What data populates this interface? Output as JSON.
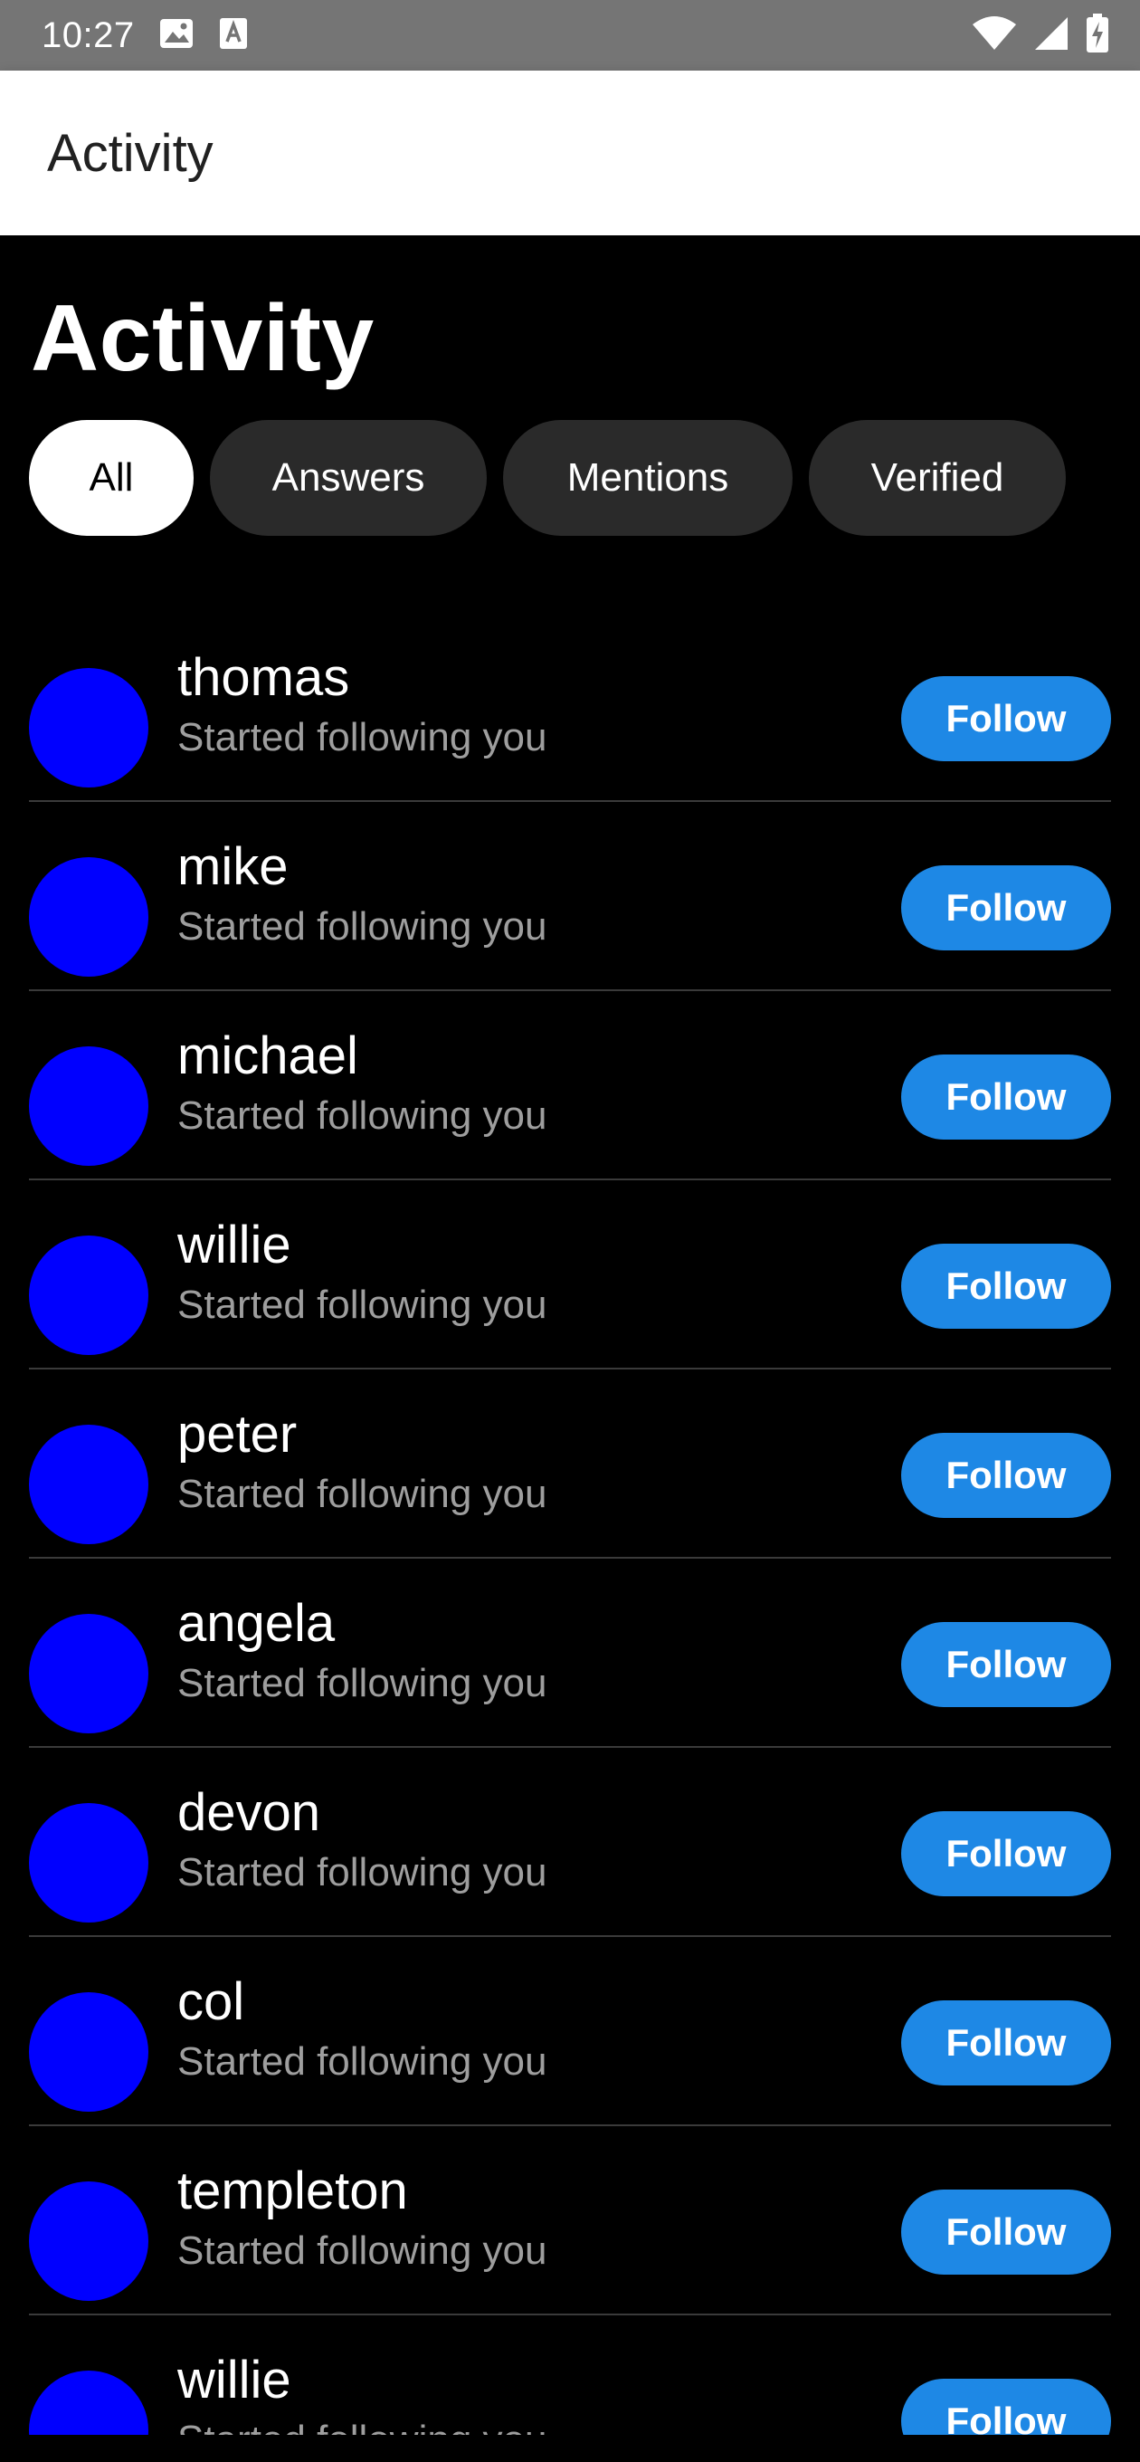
{
  "status_bar": {
    "time": "10:27",
    "icons_left": [
      "image-icon",
      "text-a-icon"
    ],
    "icons_right": [
      "wifi-icon",
      "signal-icon",
      "battery-charging-icon"
    ]
  },
  "app_bar": {
    "title": "Activity"
  },
  "page": {
    "heading": "Activity"
  },
  "filters": [
    {
      "label": "All",
      "selected": true
    },
    {
      "label": "Answers",
      "selected": false
    },
    {
      "label": "Mentions",
      "selected": false
    },
    {
      "label": "Verified",
      "selected": false
    }
  ],
  "activity": [
    {
      "name": "thomas",
      "subtitle": "Started following you",
      "action": "Follow"
    },
    {
      "name": "mike",
      "subtitle": "Started following you",
      "action": "Follow"
    },
    {
      "name": "michael",
      "subtitle": "Started following you",
      "action": "Follow"
    },
    {
      "name": "willie",
      "subtitle": "Started following you",
      "action": "Follow"
    },
    {
      "name": "peter",
      "subtitle": "Started following you",
      "action": "Follow"
    },
    {
      "name": "angela",
      "subtitle": "Started following you",
      "action": "Follow"
    },
    {
      "name": "devon",
      "subtitle": "Started following you",
      "action": "Follow"
    },
    {
      "name": "col",
      "subtitle": "Started following you",
      "action": "Follow"
    },
    {
      "name": "templeton",
      "subtitle": "Started following you",
      "action": "Follow"
    },
    {
      "name": "willie",
      "subtitle": "Started following you",
      "action": "Follow"
    }
  ],
  "colors": {
    "avatar": "#0000ff",
    "follow_button": "#1e88e5",
    "background": "#000000",
    "chip_inactive": "#2a2a2a",
    "chip_active": "#ffffff"
  }
}
